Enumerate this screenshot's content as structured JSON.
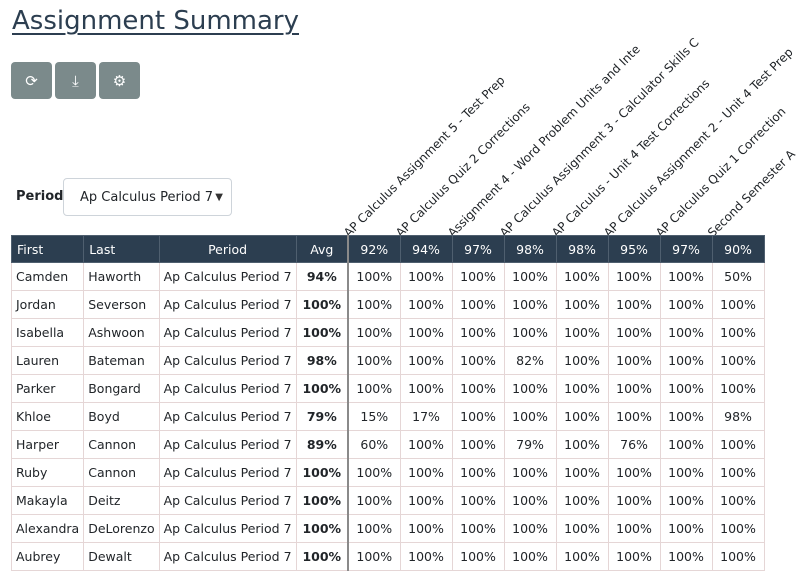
{
  "page": {
    "title": "Assignment Summary"
  },
  "toolbar": {
    "buttons": [
      {
        "icon": "refresh-icon",
        "glyph": "⟳"
      },
      {
        "icon": "download-icon",
        "glyph": "⤓"
      },
      {
        "icon": "gear-icon",
        "glyph": "⚙"
      }
    ]
  },
  "period": {
    "label": "Period:",
    "selected": "Ap Calculus Period 7"
  },
  "assignments": [
    {
      "name": "AP Calculus Assignment 5 - Test Prep",
      "avg": "92%"
    },
    {
      "name": "AP Calculus Quiz 2 Corrections",
      "avg": "94%"
    },
    {
      "name": "Assignment 4 - Word Problem Units and Inte",
      "avg": "97%"
    },
    {
      "name": "AP Calculus Assignment 3 - Calculator Skills C",
      "avg": "98%"
    },
    {
      "name": "AP Calculus - Unit 4 Test Corrections",
      "avg": "98%"
    },
    {
      "name": "AP Calculus Assignment 2 - Unit 4 Test Prep",
      "avg": "95%"
    },
    {
      "name": "AP Calculus Quiz 1 Correction",
      "avg": "97%"
    },
    {
      "name": "Second Semester A",
      "avg": "90%"
    }
  ],
  "table": {
    "headers": {
      "first": "First",
      "last": "Last",
      "period": "Period",
      "avg": "Avg"
    },
    "rows": [
      {
        "first": "Camden",
        "last": "Haworth",
        "period": "Ap Calculus Period 7",
        "avg": "94%",
        "scores": [
          "100%",
          "100%",
          "100%",
          "100%",
          "100%",
          "100%",
          "100%",
          "50%"
        ]
      },
      {
        "first": "Jordan",
        "last": "Severson",
        "period": "Ap Calculus Period 7",
        "avg": "100%",
        "scores": [
          "100%",
          "100%",
          "100%",
          "100%",
          "100%",
          "100%",
          "100%",
          "100%"
        ]
      },
      {
        "first": "Isabella",
        "last": "Ashwoon",
        "period": "Ap Calculus Period 7",
        "avg": "100%",
        "scores": [
          "100%",
          "100%",
          "100%",
          "100%",
          "100%",
          "100%",
          "100%",
          "100%"
        ]
      },
      {
        "first": "Lauren",
        "last": "Bateman",
        "period": "Ap Calculus Period 7",
        "avg": "98%",
        "scores": [
          "100%",
          "100%",
          "100%",
          "82%",
          "100%",
          "100%",
          "100%",
          "100%"
        ]
      },
      {
        "first": "Parker",
        "last": "Bongard",
        "period": "Ap Calculus Period 7",
        "avg": "100%",
        "scores": [
          "100%",
          "100%",
          "100%",
          "100%",
          "100%",
          "100%",
          "100%",
          "100%"
        ]
      },
      {
        "first": "Khloe",
        "last": "Boyd",
        "period": "Ap Calculus Period 7",
        "avg": "79%",
        "scores": [
          "15%",
          "17%",
          "100%",
          "100%",
          "100%",
          "100%",
          "100%",
          "98%"
        ]
      },
      {
        "first": "Harper",
        "last": "Cannon",
        "period": "Ap Calculus Period 7",
        "avg": "89%",
        "scores": [
          "60%",
          "100%",
          "100%",
          "79%",
          "100%",
          "76%",
          "100%",
          "100%"
        ]
      },
      {
        "first": "Ruby",
        "last": "Cannon",
        "period": "Ap Calculus Period 7",
        "avg": "100%",
        "scores": [
          "100%",
          "100%",
          "100%",
          "100%",
          "100%",
          "100%",
          "100%",
          "100%"
        ]
      },
      {
        "first": "Makayla",
        "last": "Deitz",
        "period": "Ap Calculus Period 7",
        "avg": "100%",
        "scores": [
          "100%",
          "100%",
          "100%",
          "100%",
          "100%",
          "100%",
          "100%",
          "100%"
        ]
      },
      {
        "first": "Alexandra",
        "last": "DeLorenzo",
        "period": "Ap Calculus Period 7",
        "avg": "100%",
        "scores": [
          "100%",
          "100%",
          "100%",
          "100%",
          "100%",
          "100%",
          "100%",
          "100%"
        ]
      },
      {
        "first": "Aubrey",
        "last": "Dewalt",
        "period": "Ap Calculus Period 7",
        "avg": "100%",
        "scores": [
          "100%",
          "100%",
          "100%",
          "100%",
          "100%",
          "100%",
          "100%",
          "100%"
        ]
      }
    ]
  }
}
